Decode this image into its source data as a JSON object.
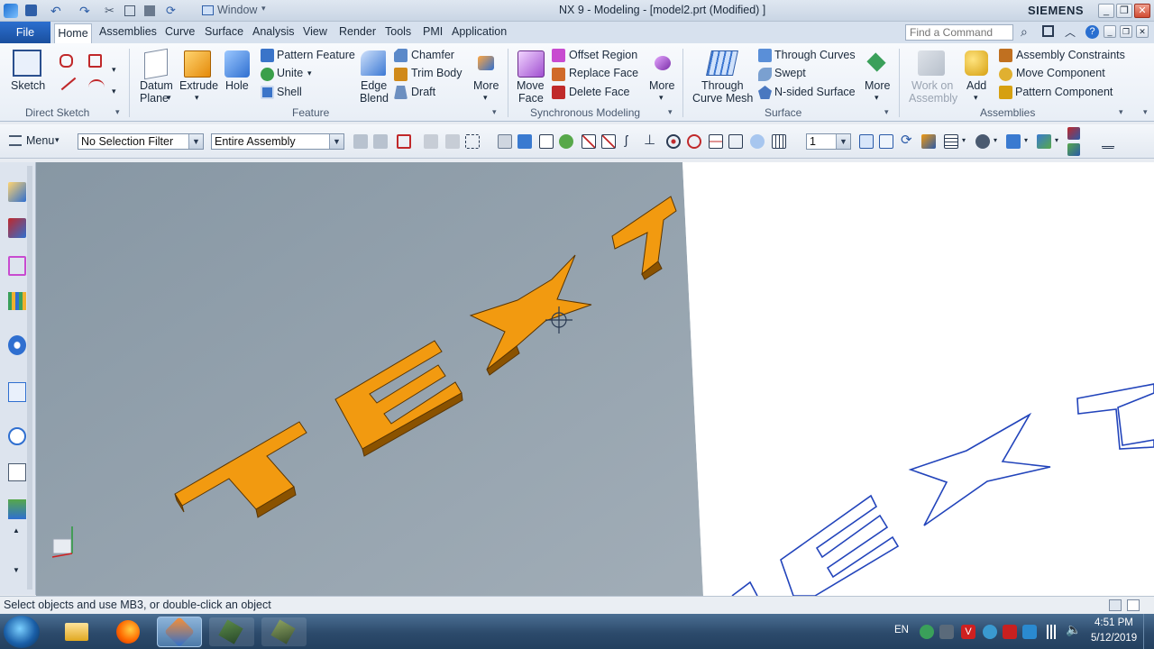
{
  "window": {
    "title": "NX 9 - Modeling - [model2.prt (Modified) ]",
    "brand": "SIEMENS",
    "quick_menu": "Window",
    "controls": [
      "_",
      "❐",
      "✕"
    ]
  },
  "menubar": {
    "file": "File",
    "tabs": [
      "Home",
      "Assemblies",
      "Curve",
      "Surface",
      "Analysis",
      "View",
      "Render",
      "Tools",
      "PMI",
      "Application"
    ],
    "search_placeholder": "Find a Command"
  },
  "ribbon": {
    "direct_sketch": {
      "group": "Direct Sketch",
      "sketch": "Sketch"
    },
    "feature": {
      "group": "Feature",
      "datum_plane_1": "Datum",
      "datum_plane_2": "Plane",
      "extrude": "Extrude",
      "hole": "Hole",
      "pattern_feature": "Pattern Feature",
      "unite": "Unite",
      "shell": "Shell",
      "edge_blend_1": "Edge",
      "edge_blend_2": "Blend",
      "chamfer": "Chamfer",
      "trim_body": "Trim Body",
      "draft": "Draft",
      "more": "More"
    },
    "synchronous": {
      "group": "Synchronous Modeling",
      "move_face_1": "Move",
      "move_face_2": "Face",
      "offset_region": "Offset Region",
      "replace_face": "Replace Face",
      "delete_face": "Delete Face",
      "more": "More"
    },
    "surface": {
      "group": "Surface",
      "through_curve_mesh_1": "Through",
      "through_curve_mesh_2": "Curve Mesh",
      "through_curves": "Through Curves",
      "swept": "Swept",
      "n_sided": "N-sided Surface",
      "more": "More"
    },
    "assemblies": {
      "group": "Assemblies",
      "work_on_1": "Work on",
      "work_on_2": "Assembly",
      "add": "Add",
      "assembly_constraints": "Assembly Constraints",
      "move_component": "Move Component",
      "pattern_component": "Pattern Component"
    }
  },
  "selection_bar": {
    "menu": "Menu",
    "filter": "No Selection Filter",
    "scope": "Entire Assembly",
    "layer": "1"
  },
  "viewport": {
    "model_text": [
      "T",
      "E",
      "X",
      "T"
    ],
    "left_bg": "#93a2ad",
    "right_bg": "#ffffff",
    "extrude_color": "#f29a10",
    "wire_color": "#2244bb"
  },
  "statusbar": {
    "message": "Select objects and use MB3, or double-click an object"
  },
  "taskbar": {
    "language": "EN",
    "time": "4:51 PM",
    "date": "5/12/2019"
  }
}
